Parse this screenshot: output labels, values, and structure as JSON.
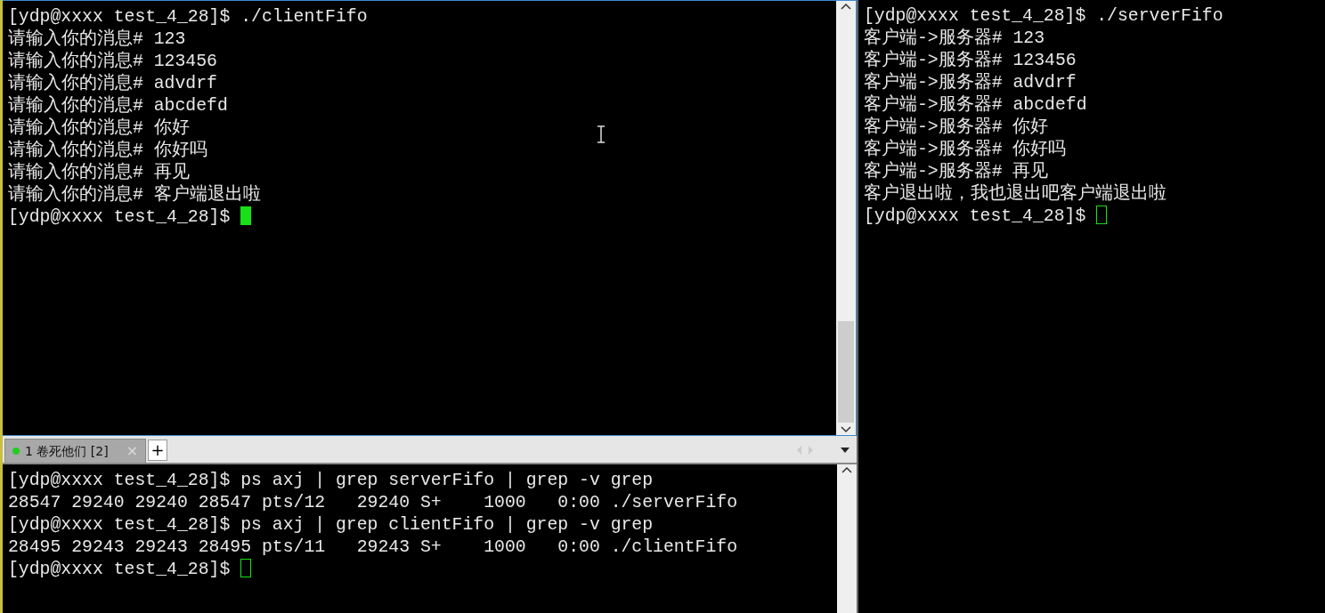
{
  "client_terminal": {
    "lines": [
      "[ydp@xxxx test_4_28]$ ./clientFifo",
      "请输入你的消息# 123",
      "请输入你的消息# 123456",
      "请输入你的消息# advdrf",
      "请输入你的消息# abcdefd",
      "请输入你的消息# 你好",
      "请输入你的消息# 你好吗",
      "请输入你的消息# 再见",
      "请输入你的消息# 客户端退出啦"
    ],
    "prompt": "[ydp@xxxx test_4_28]$ ",
    "cursor_focused": true
  },
  "tabs": [
    {
      "label": "1 卷死他们 [2]",
      "selected": true,
      "color": "#22cc22",
      "close": "×"
    }
  ],
  "new_tab": "+",
  "shell_terminal": {
    "lines": [
      "[ydp@xxxx test_4_28]$ ps axj | grep serverFifo | grep -v grep",
      "28547 29240 29240 28547 pts/12   29240 S+    1000   0:00 ./serverFifo",
      "[ydp@xxxx test_4_28]$ ps axj | grep clientFifo | grep -v grep",
      "28495 29243 29243 28495 pts/11   29243 S+    1000   0:00 ./clientFifo"
    ],
    "prompt": "[ydp@xxxx test_4_28]$ ",
    "cursor_focused": false
  },
  "server_terminal": {
    "lines": [
      "[ydp@xxxx test_4_28]$ ./serverFifo",
      "客户端->服务器# 123",
      "客户端->服务器# 123456",
      "客户端->服务器# advdrf",
      "客户端->服务器# abcdefd",
      "客户端->服务器# 你好",
      "客户端->服务器# 你好吗",
      "客户端->服务器# 再见",
      "客户退出啦，我也退出吧客户端退出啦"
    ],
    "prompt": "[ydp@xxxx test_4_28]$ ",
    "cursor_focused": false
  }
}
